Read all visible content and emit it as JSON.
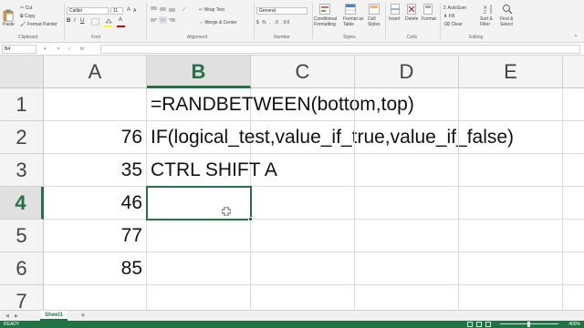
{
  "ribbon": {
    "clipboard": {
      "cut": "Cut",
      "copy": "Copy",
      "paste": "Paste",
      "format_painter": "Format Painter",
      "group": "Clipboard"
    },
    "font": {
      "name": "Calibri",
      "size": "11",
      "group": "Font"
    },
    "alignment": {
      "wrap_text": "Wrap Text",
      "merge_center": "Merge & Center",
      "group": "Alignment"
    },
    "number": {
      "format": "General",
      "group": "Number"
    },
    "styles": {
      "conditional": "Conditional",
      "conditional2": "Formatting",
      "format_as": "Format as",
      "format_as2": "Table",
      "cell_styles": "Cell",
      "cell_styles2": "Styles",
      "group": "Styles"
    },
    "cells": {
      "insert": "Insert",
      "delete": "Delete",
      "format": "Format",
      "group": "Cells"
    },
    "editing": {
      "autosum": "AutoSum",
      "fill": "Fill",
      "clear": "Clear",
      "sort": "Sort &",
      "sort2": "Filter",
      "find": "Find &",
      "find2": "Select",
      "group": "Editing"
    },
    "colors": {
      "font_highlight": "#ffff00",
      "font_color": "#c00000"
    }
  },
  "formula_bar": {
    "name_box": "B4",
    "content": ""
  },
  "grid": {
    "columns": [
      "A",
      "B",
      "C",
      "D",
      "E"
    ],
    "selected_column": "B",
    "rows": [
      "1",
      "2",
      "3",
      "4",
      "5",
      "6",
      "7"
    ],
    "selected_row": "4",
    "cells": {
      "B1": "=RANDBETWEEN(bottom,top)",
      "A2": "76",
      "B2": "IF(logical_test,value_if_true,value_if_false)",
      "A3": "35",
      "B3": "CTRL SHIFT A",
      "A4": "46",
      "A5": "77",
      "A6": "85"
    },
    "active_cell": "B4"
  },
  "sheet_tabs": {
    "active": "Sheet1",
    "add": "+"
  },
  "status_bar": {
    "ready": "READY",
    "zoom": "400%"
  },
  "theme": {
    "accent": "#217346"
  }
}
